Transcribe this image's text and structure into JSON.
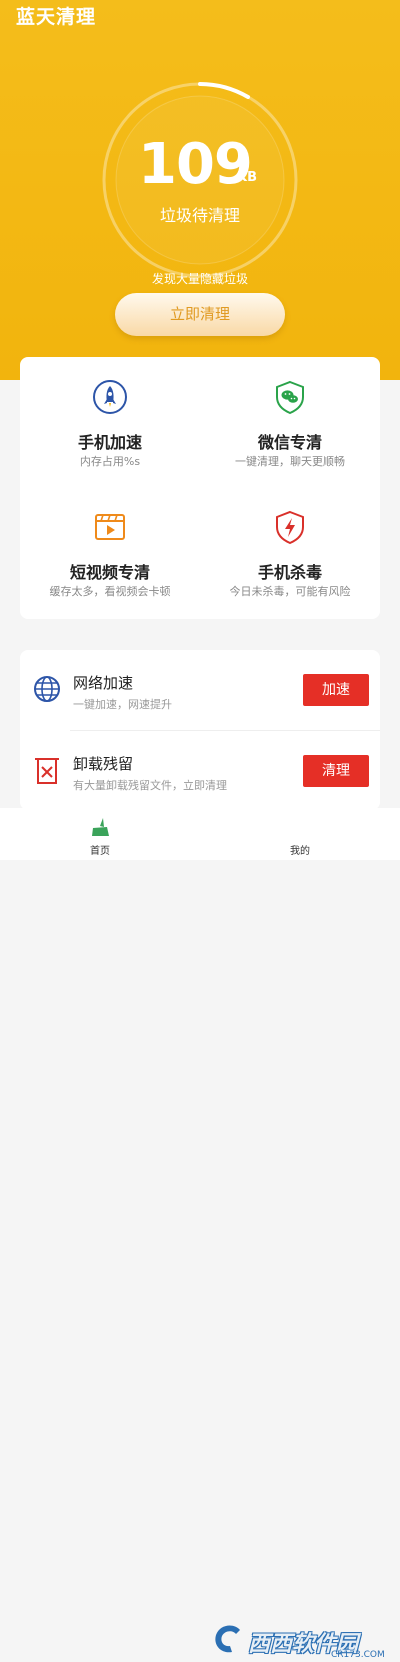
{
  "app": {
    "title": "蓝天清理"
  },
  "scan": {
    "value": "109",
    "unit": "KB",
    "caption": "垃圾待清理",
    "notice": "发现大量隐藏垃圾",
    "clean_button": "立即清理"
  },
  "features": [
    {
      "title": "手机加速",
      "subtitle": "内存占用%s",
      "icon": "rocket-icon"
    },
    {
      "title": "微信专清",
      "subtitle": "一键清理，聊天更顺畅",
      "icon": "wechat-shield-icon"
    },
    {
      "title": "短视频专清",
      "subtitle": "缓存太多，看视频会卡顿",
      "icon": "video-icon"
    },
    {
      "title": "手机杀毒",
      "subtitle": "今日未杀毒，可能有风险",
      "icon": "virus-shield-icon"
    }
  ],
  "tools": [
    {
      "title": "网络加速",
      "subtitle": "一键加速，网速提升",
      "button": "加速",
      "icon": "globe-icon"
    },
    {
      "title": "卸载残留",
      "subtitle": "有大量卸载残留文件，立即清理",
      "button": "清理",
      "icon": "trash-icon"
    }
  ],
  "tabbar": {
    "home": "首页",
    "mine": "我的"
  },
  "watermark": {
    "text": "西西软件园",
    "sub": "CR173.COM"
  },
  "colors": {
    "hero": "#f4bd1b",
    "accent_red": "#e52f26",
    "button_text": "#e09a22"
  }
}
